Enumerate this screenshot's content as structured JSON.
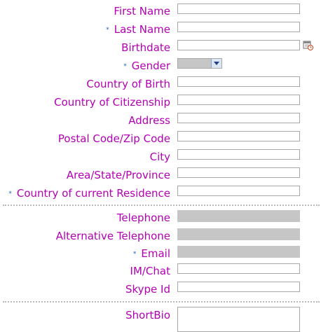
{
  "fields": [
    {
      "label": "First Name",
      "required": false
    },
    {
      "label": "Last Name",
      "required": true
    },
    {
      "label": "Birthdate",
      "required": false
    },
    {
      "label": "Gender",
      "required": true
    },
    {
      "label": "Country of Birth",
      "required": false
    },
    {
      "label": "Country of Citizenship",
      "required": false
    },
    {
      "label": "Address",
      "required": false
    },
    {
      "label": "Postal Code/Zip Code",
      "required": false
    },
    {
      "label": "City",
      "required": false
    },
    {
      "label": "Area/State/Province",
      "required": false
    },
    {
      "label": "Country of current Residence",
      "required": true
    }
  ],
  "contact": [
    {
      "label": "Telephone",
      "required": false
    },
    {
      "label": "Alternative Telephone",
      "required": false
    },
    {
      "label": "Email",
      "required": true
    },
    {
      "label": "IM/Chat",
      "required": false
    },
    {
      "label": "Skype Id",
      "required": false
    }
  ],
  "bio": {
    "label": "ShortBio",
    "required": false
  },
  "required_marker": "*",
  "icons": {
    "calendar": "calendar-icon",
    "dropdown": "chevron-down-icon"
  },
  "colors": {
    "label": "#b300b3",
    "required_marker": "#1f5fb4",
    "disabled_field": "#c6c6c6"
  }
}
